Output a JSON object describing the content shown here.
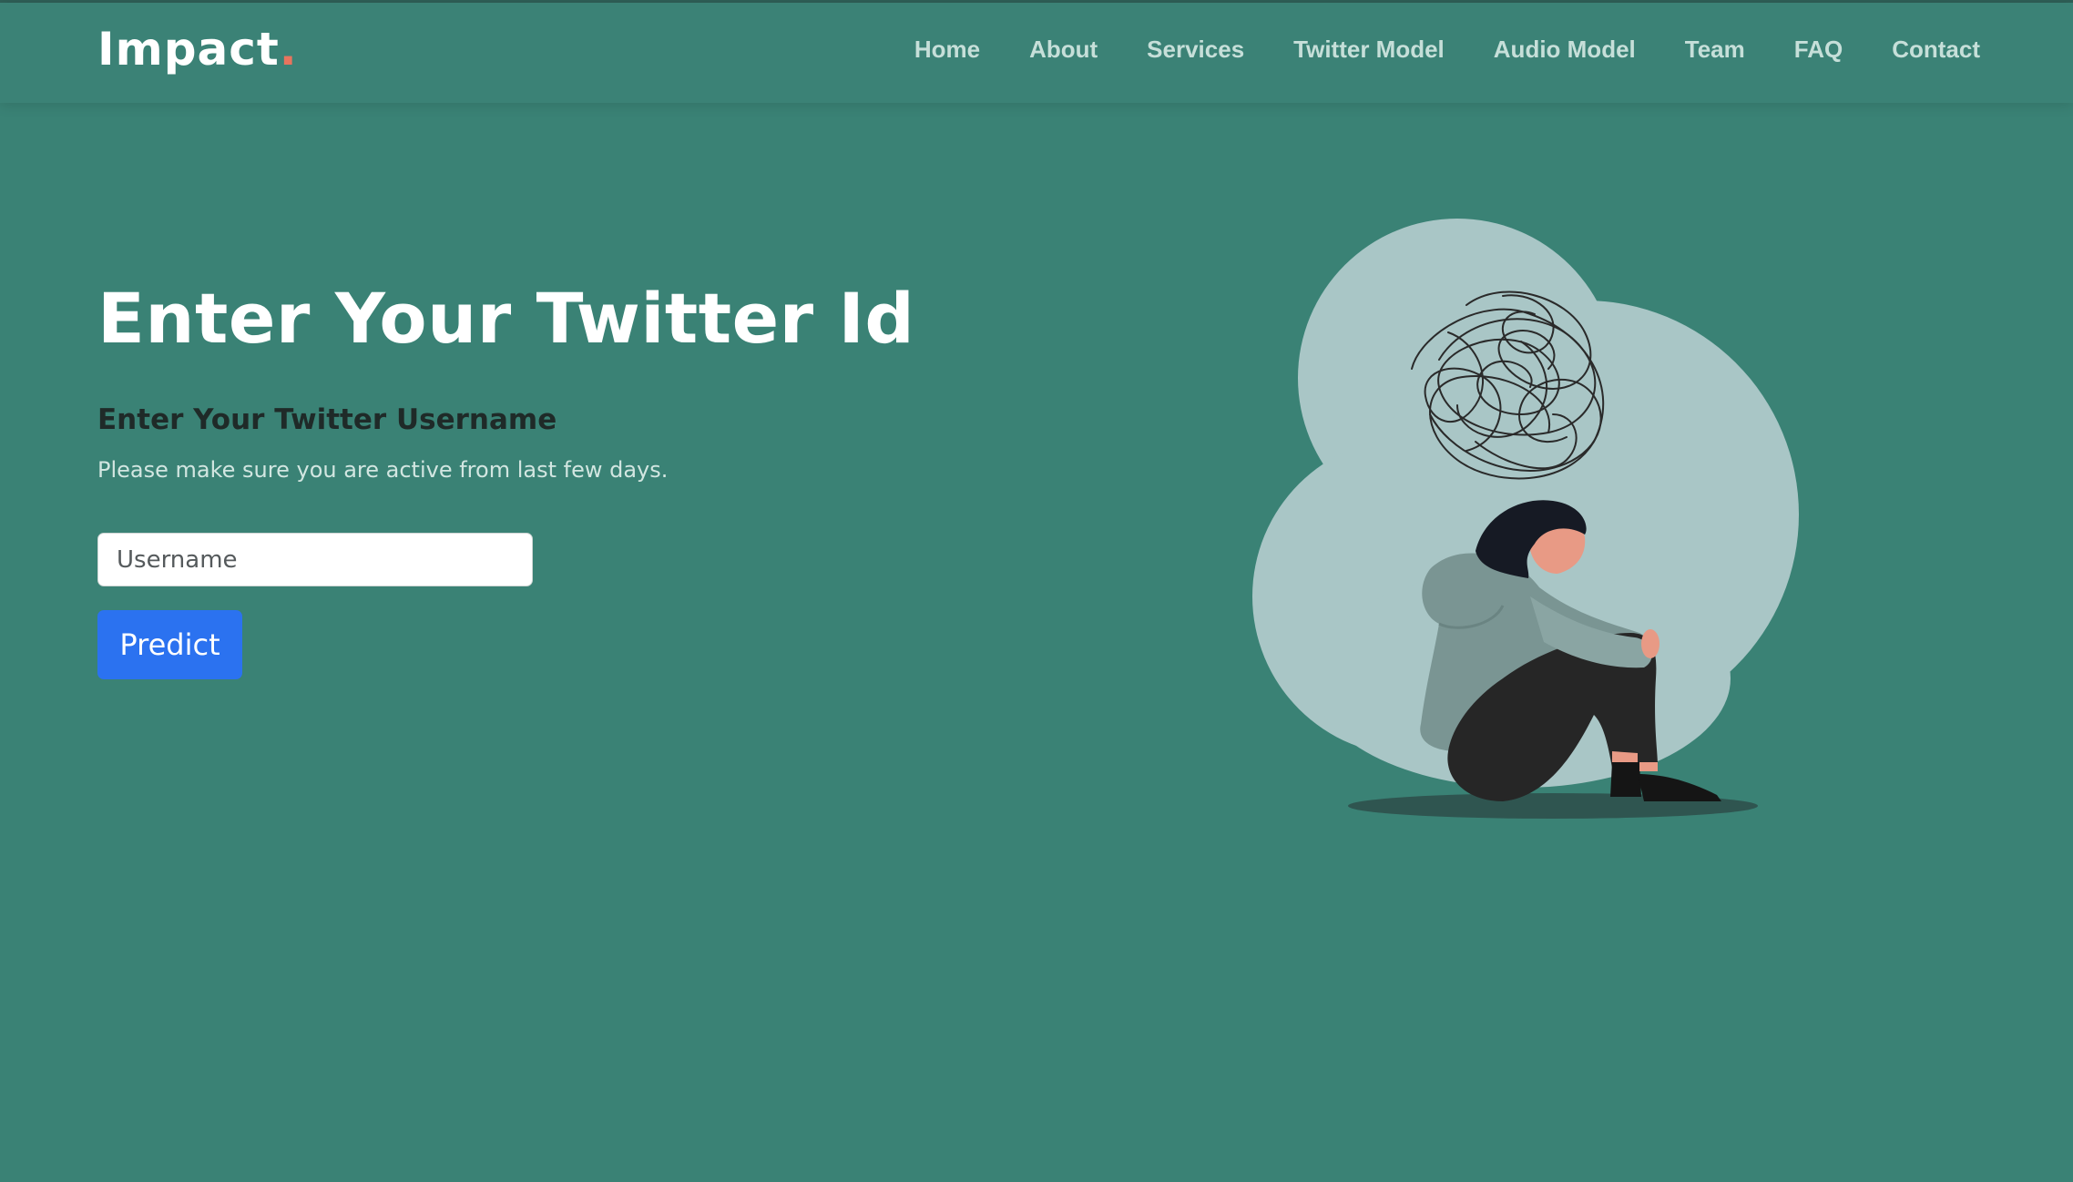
{
  "header": {
    "logo_text": "Impact",
    "logo_dot": ".",
    "nav": [
      {
        "label": "Home"
      },
      {
        "label": "About"
      },
      {
        "label": "Services"
      },
      {
        "label": "Twitter Model"
      },
      {
        "label": "Audio Model"
      },
      {
        "label": "Team"
      },
      {
        "label": "FAQ"
      },
      {
        "label": "Contact"
      }
    ]
  },
  "hero": {
    "title": "Enter Your Twitter Id",
    "subheading": "Enter Your Twitter Username",
    "hint": "Please make sure you are active from last few days.",
    "input_placeholder": "Username",
    "input_value": "",
    "button_label": "Predict"
  },
  "illustration": {
    "icon": "anxious-person-illustration"
  },
  "colors": {
    "background": "#3a8275",
    "logo_dot": "#e8745e",
    "button": "#2b72f0"
  }
}
